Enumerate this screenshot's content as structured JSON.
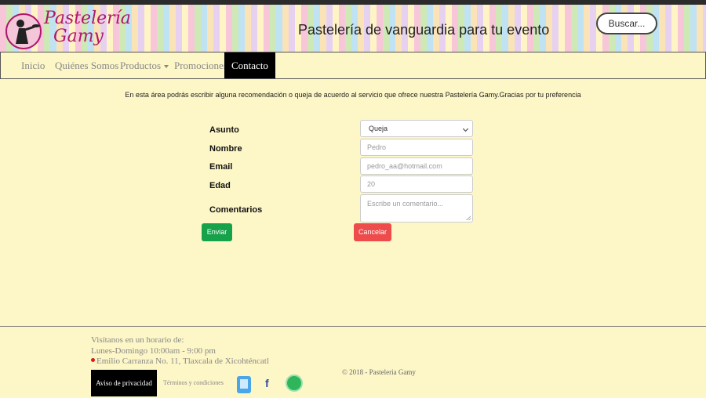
{
  "header": {
    "logo_line1": "Pastelería",
    "logo_line2": "Gamy",
    "tagline": "Pastelería de vanguardia para tu evento",
    "search_label": "Buscar..."
  },
  "nav": {
    "items": [
      "Inicio",
      "Quiénes Somos",
      "Productos",
      "Promociones",
      "Contacto"
    ],
    "active": "Contacto"
  },
  "intro": "En esta área podrás escribir alguna recomendación o queja de acuerdo al servicio que ofrece nuestra Pastelería Gamy.Gracias por tu preferencia",
  "form": {
    "asunto_label": "Asunto",
    "asunto_value": "Queja",
    "nombre_label": "Nombre",
    "nombre_placeholder": "Pedro",
    "email_label": "Email",
    "email_placeholder": "pedro_aa@hotmail.com",
    "edad_label": "Edad",
    "edad_placeholder": "20",
    "comentarios_label": "Comentarios",
    "comentarios_placeholder": "Escribe un comentario...",
    "send_label": "Enviar",
    "cancel_label": "Cancelar"
  },
  "footer": {
    "hours_title": "Visítanos en un horario de:",
    "hours": "Lunes-Domingo 10:00am - 9:00 pm",
    "address": "Emilio Carranza No. 11, Tlaxcala de Xicohténcatl",
    "privacy_label": "Aviso de privacidad",
    "terms_label": "Términos y condiciones",
    "copyright": "© 2018 - Pasteleria Gamy"
  },
  "colors": {
    "background": "#fdf6c7",
    "send": "#15a24a",
    "cancel": "#ee4b4b"
  }
}
